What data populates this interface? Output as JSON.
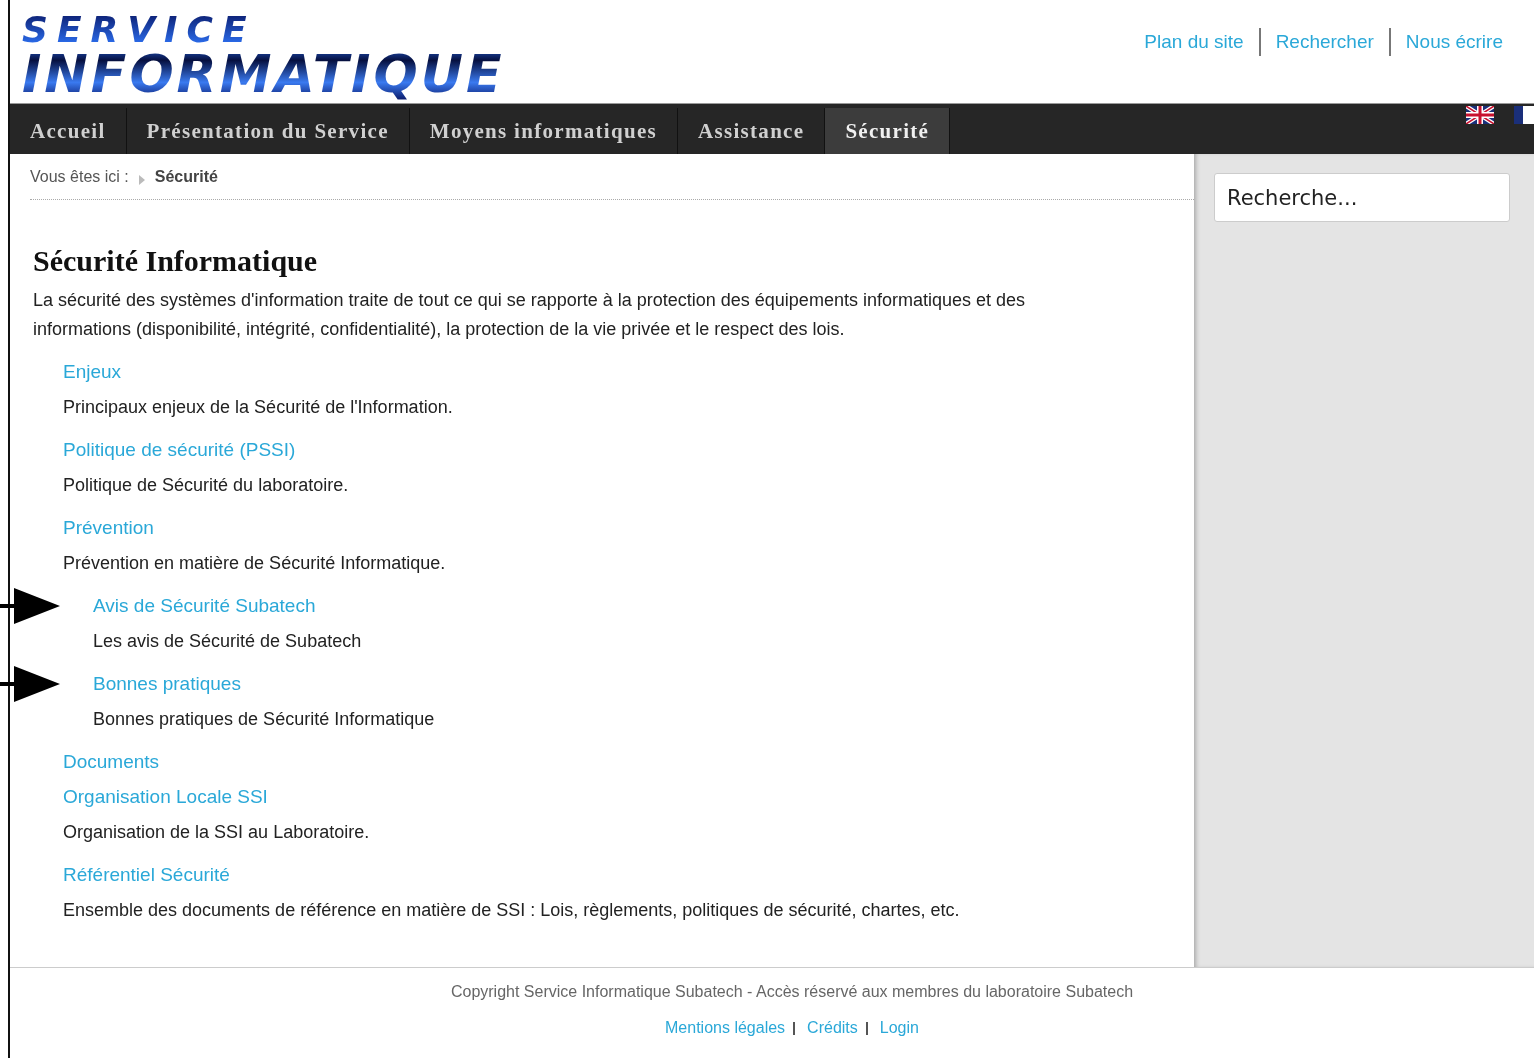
{
  "header": {
    "logo": [
      "SERVICE",
      "INFORMATIQUE"
    ],
    "links": [
      "Plan du site",
      "Rechercher",
      "Nous écrire"
    ]
  },
  "nav": {
    "items": [
      {
        "label": "Accueil",
        "selected": false
      },
      {
        "label": "Présentation du Service",
        "selected": false
      },
      {
        "label": "Moyens informatiques",
        "selected": false
      },
      {
        "label": "Assistance",
        "selected": false
      },
      {
        "label": "Sécurité",
        "selected": true
      }
    ]
  },
  "breadcrumb": {
    "prefix": "Vous êtes ici :",
    "current": "Sécurité"
  },
  "search": {
    "placeholder": "Recherche..."
  },
  "content": {
    "title": "Sécurité Informatique",
    "intro": "La sécurité des systèmes d'information traite de tout ce qui se rapporte à la protection des équipements informatiques et des informations (disponibilité, intégrité, confidentialité), la protection de la vie privée et le respect des lois.",
    "sections": [
      {
        "link": "Enjeux",
        "description": "Principaux enjeux de la Sécurité de l'Information."
      },
      {
        "link": "Politique de sécurité (PSSI)",
        "description": "Politique de Sécurité du laboratoire."
      },
      {
        "link": "Prévention",
        "description": "Prévention en matière de Sécurité Informatique.",
        "children": [
          {
            "link": "Avis de Sécurité Subatech",
            "description": "Les avis de Sécurité de Subatech",
            "marked": true
          },
          {
            "link": "Bonnes pratiques",
            "description": "Bonnes pratiques de Sécurité Informatique",
            "marked": true
          }
        ]
      },
      {
        "link": "Documents"
      },
      {
        "link": "Organisation Locale SSI",
        "description": "Organisation de la SSI au Laboratoire."
      },
      {
        "link": "Référentiel Sécurité",
        "description": "Ensemble des documents de référence en matière de SSI : Lois, règlements, politiques de sécurité, chartes, etc."
      }
    ]
  },
  "footer": {
    "copyright": "Copyright Service Informatique Subatech - Accès réservé aux membres du laboratoire Subatech",
    "links": [
      "Mentions légales",
      "Crédits",
      "Login"
    ]
  }
}
